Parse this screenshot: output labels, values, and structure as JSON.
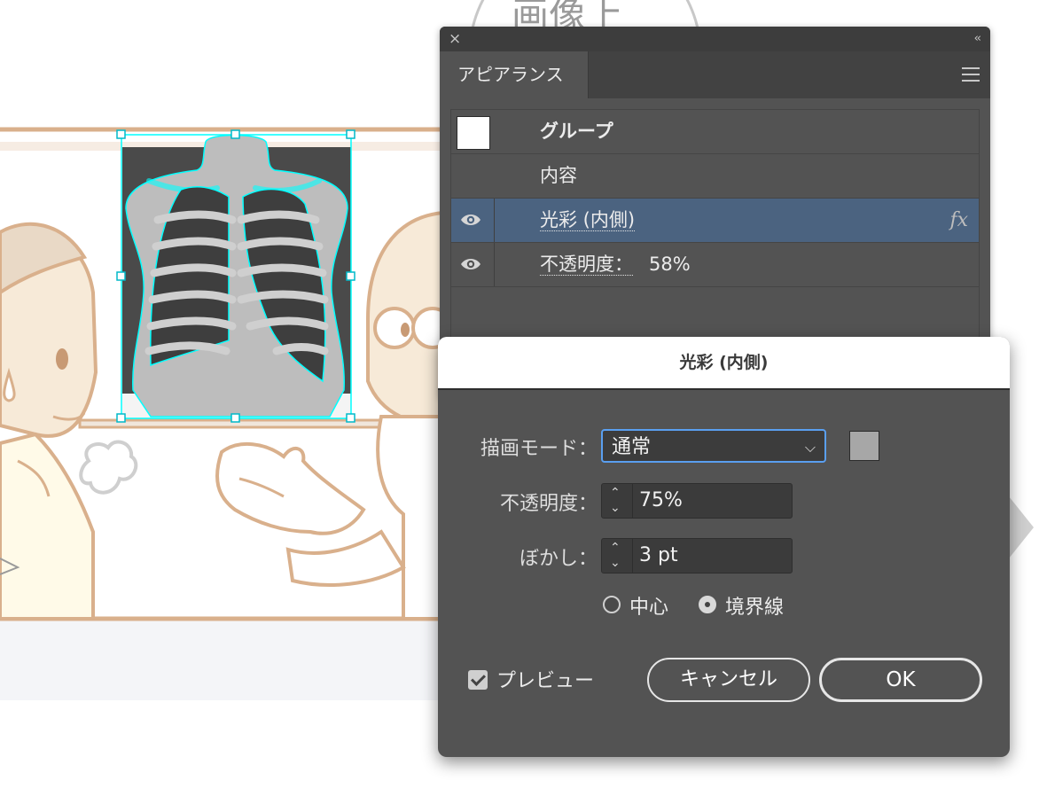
{
  "canvas": {
    "label": "画像上"
  },
  "appearance_panel": {
    "close": "×",
    "collapse": "‹‹",
    "tab": "アピアランス",
    "rows": [
      {
        "label": "グループ"
      },
      {
        "label": "内容"
      },
      {
        "label": "光彩 (内側)",
        "fx": "fx"
      },
      {
        "label": "不透明度：",
        "value": "58%"
      }
    ]
  },
  "dialog": {
    "title": "光彩 (内側)",
    "blend_mode": {
      "label": "描画モード：",
      "value": "通常"
    },
    "opacity": {
      "label": "不透明度：",
      "value": "75%"
    },
    "blur": {
      "label": "ぼかし：",
      "value": "3 pt"
    },
    "radio": {
      "center": "中心",
      "edge": "境界線",
      "selected": "edge"
    },
    "preview": {
      "label": "プレビュー",
      "checked": true
    },
    "cancel_label": "キャンセル",
    "ok_label": "OK",
    "swatch_color": "#a7a7a7"
  },
  "colors": {
    "selection": "#00ffff",
    "outline": "#d9b08c",
    "panel_bg": "#535353",
    "selected_row": "#4b6380",
    "focus": "#5a9ff0"
  }
}
